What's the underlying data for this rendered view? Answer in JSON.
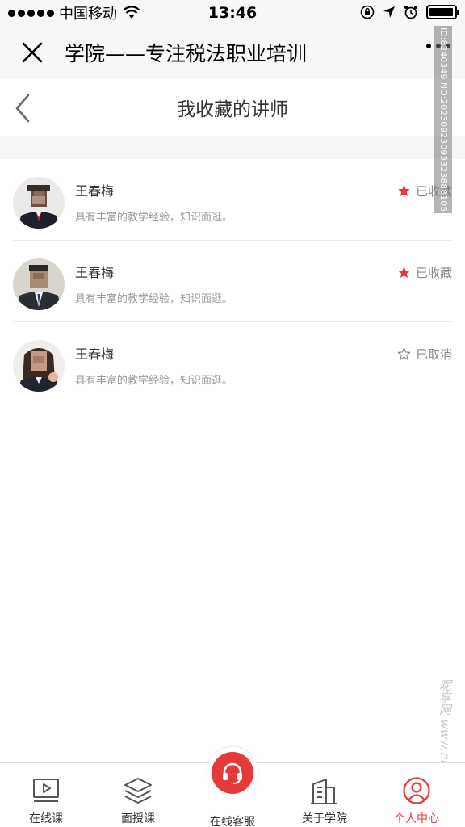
{
  "status_bar": {
    "carrier": "中国移动",
    "time": "13:46",
    "battery_level": 0.95
  },
  "titlebar": {
    "title": "学院——专注税法职业培训"
  },
  "watermark": {
    "id_text": "ID:8240349 NO:20230923093323888105",
    "site_text": "昵享网 www.nipic.cn"
  },
  "page": {
    "title": "我收藏的讲师"
  },
  "lecturers": [
    {
      "name": "王春梅",
      "desc": "具有丰富的教学经验，知识面逛。",
      "status": "已收藏",
      "favorited": true
    },
    {
      "name": "王春梅",
      "desc": "具有丰富的教学经验，知识面逛。",
      "status": "已收藏",
      "favorited": true
    },
    {
      "name": "王春梅",
      "desc": "具有丰富的教学经验，知识面逛。",
      "status": "已取消",
      "favorited": false
    }
  ],
  "tabbar": {
    "tabs": [
      {
        "label": "在线课",
        "icon": "video-icon"
      },
      {
        "label": "面授课",
        "icon": "layers-icon"
      },
      {
        "label": "在线客服",
        "icon": "headset-icon"
      },
      {
        "label": "关于学院",
        "icon": "building-icon"
      },
      {
        "label": "个人中心",
        "icon": "user-icon"
      }
    ],
    "active_index": 4
  },
  "colors": {
    "accent": "#e53a3a",
    "star_active": "#e53a3a",
    "text_muted": "#999999"
  }
}
